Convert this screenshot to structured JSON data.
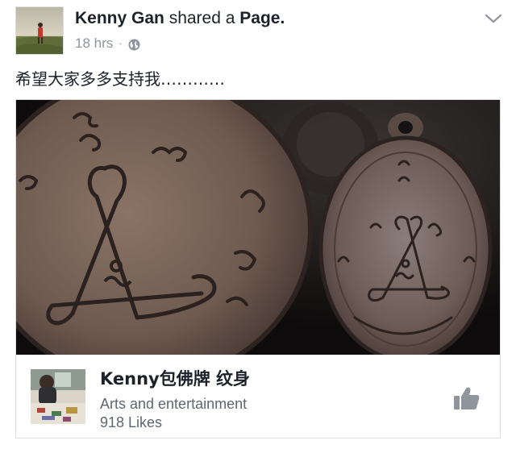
{
  "post": {
    "author": "Kenny Gan",
    "action": "shared a",
    "object": "Page.",
    "time": "18 hrs",
    "separator": "·",
    "privacy_icon": "globe-icon",
    "menu_icon": "chevron-down-icon",
    "message": "希望大家多多支持我…………"
  },
  "card": {
    "image_description_icon": "amulet-photo",
    "page_name": "Kenny包佛牌 纹身",
    "category": "Arts and entertainment",
    "likes": "918 Likes",
    "like_icon": "thumbs-up-icon"
  },
  "colors": {
    "text_primary": "#1d2129",
    "text_secondary": "#90949c",
    "text_meta": "#606770",
    "border": "#dddfe2",
    "like_icon": "#90949c"
  }
}
